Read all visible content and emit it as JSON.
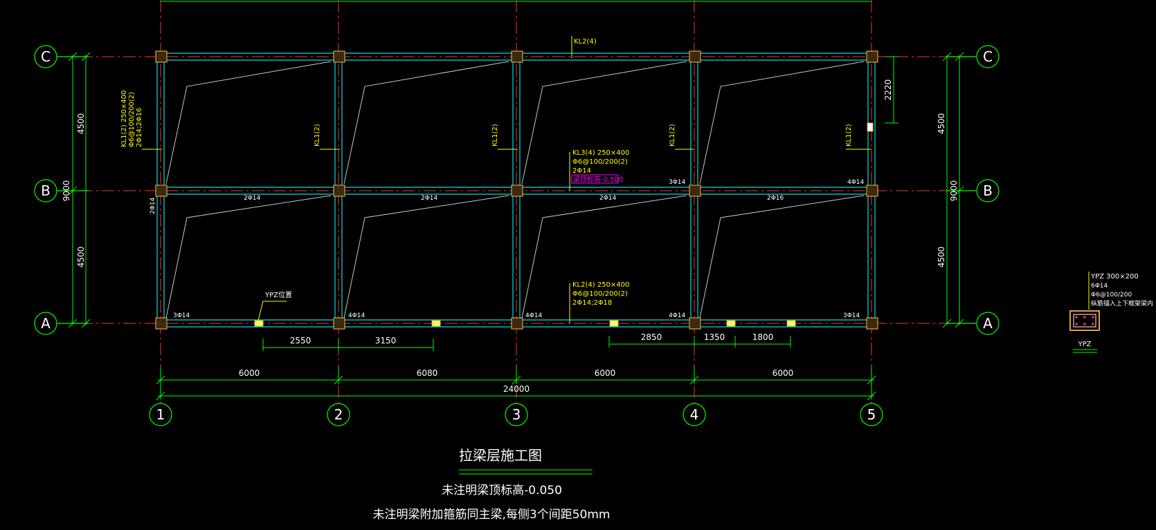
{
  "colors": {
    "bg": "#000000",
    "axis": "#ff3030",
    "beam": "#00e0e0",
    "dim": "#00ff00",
    "text": "#ffff00",
    "label": "#ffffff",
    "column": "#e0a040",
    "magenta": "#ff00ff",
    "slab": "#c8c8c8"
  },
  "grid": {
    "x_labels": [
      "1",
      "2",
      "3",
      "4",
      "5"
    ],
    "y_labels": [
      "C",
      "B",
      "A"
    ]
  },
  "dims": {
    "bays": [
      "6000",
      "6080",
      "6000",
      "6000"
    ],
    "total": "24000",
    "left_spans": [
      "4500",
      "4500"
    ],
    "left_total": "9000",
    "right_spans": [
      "4500",
      "4500"
    ],
    "right_total": "9000",
    "sub_left": [
      "2550",
      "3150"
    ],
    "sub_right": [
      "2850",
      "1350",
      "1800"
    ],
    "right_gap": "2220"
  },
  "annotations": {
    "kl2_top": "KL2(4)",
    "kl1_left_1": "KL1(2) 250×400",
    "kl1_left_2": "Φ6@100/200(2)",
    "kl1_left_3": "2Φ14;2Φ16",
    "kl1_mid": "KL1(2)",
    "kl3_1": "KL3(4) 250×400",
    "kl3_2": "Φ6@100/200(2)",
    "kl3_3": "2Φ14",
    "kl3_4": "梁顶标高-0.500",
    "kl2_bot_1": "KL2(4) 250×400",
    "kl2_bot_2": "Φ6@100/200(2)",
    "kl2_bot_3": "2Φ14;2Φ18",
    "ypz_pos": "YPZ位置",
    "b_rebar": [
      "2Φ14",
      "2Φ14",
      "2Φ14",
      "2Φ16"
    ],
    "b_3phi14": "3Φ14",
    "b_4phi14": "4Φ14",
    "left_2phi14": "2Φ14",
    "a_rebar": [
      "3Φ14",
      "4Φ14",
      "4Φ14",
      "4Φ14",
      "3Φ14"
    ]
  },
  "ypz_detail": {
    "line1": "YPZ 300×200",
    "line2": "6Φ14",
    "line3": "Φ6@100/200",
    "line4": "纵筋锚入上下框架梁内",
    "name": "YPZ"
  },
  "notes": {
    "title": "拉梁层施工图",
    "note1": "未注明梁顶标高-0.050",
    "note2": "未注明梁附加箍筋同主梁,每侧3个间距50mm"
  }
}
